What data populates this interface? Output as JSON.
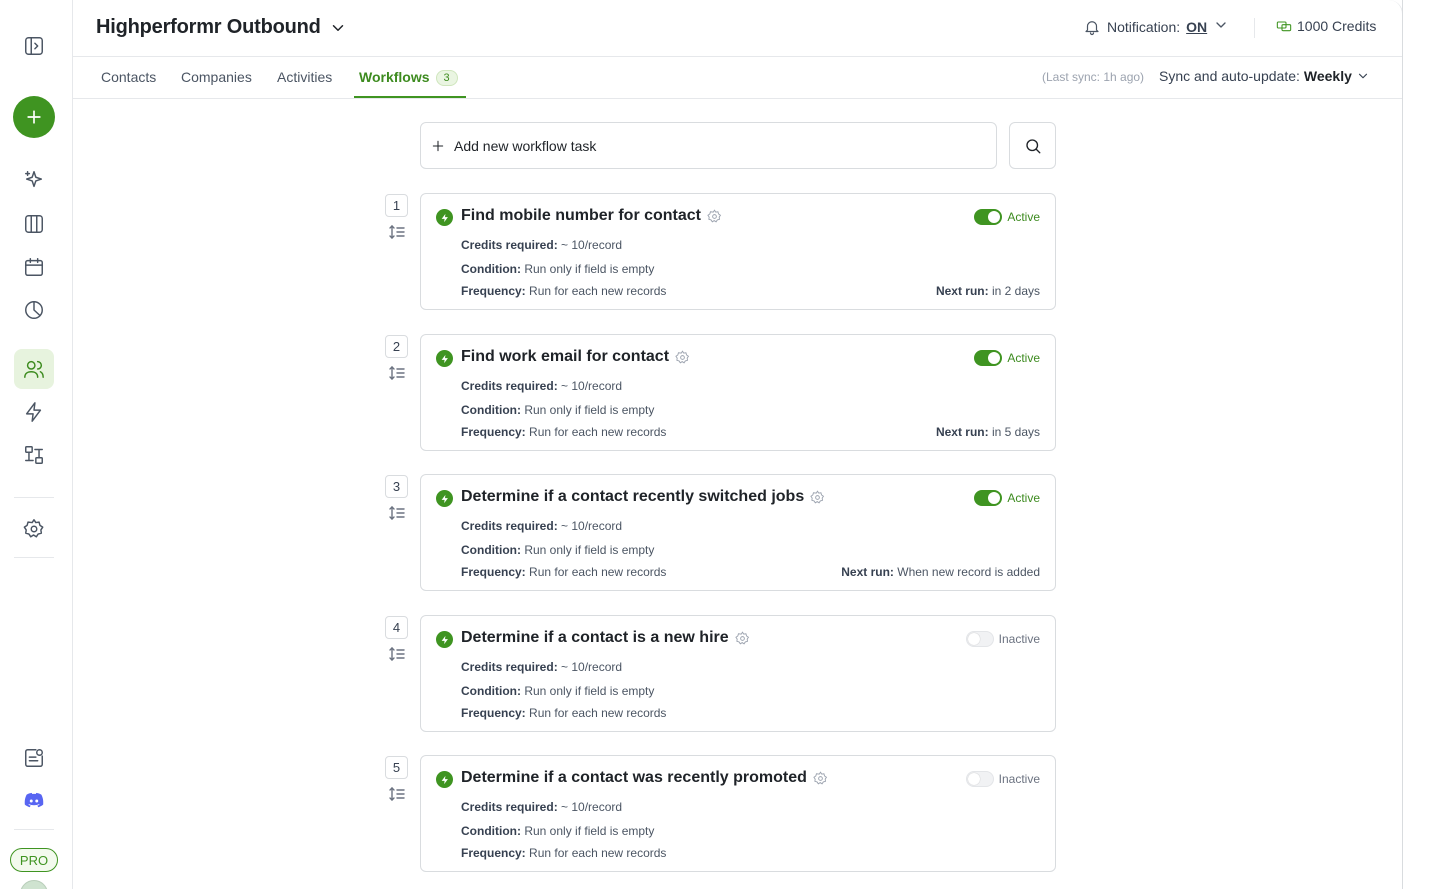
{
  "app": {
    "title": "Highperformr Outbound",
    "notification_label": "Notification:",
    "notification_value": "ON",
    "credits": "1000 Credits",
    "plan_badge": "PRO"
  },
  "tabs": [
    {
      "label": "Contacts"
    },
    {
      "label": "Companies"
    },
    {
      "label": "Activities"
    },
    {
      "label": "Workflows",
      "count": "3",
      "active": true
    }
  ],
  "sync": {
    "last_sync": "(Last sync: 1h ago)",
    "label": "Sync and auto-update:",
    "value": "Weekly"
  },
  "add_task": {
    "label": "Add new workflow task"
  },
  "labels": {
    "credits": "Credits required:",
    "condition": "Condition:",
    "frequency": "Frequency:",
    "next_run": "Next run:"
  },
  "workflows": [
    {
      "index": "1",
      "title": "Find mobile number for contact",
      "status": "Active",
      "credits": "~ 10/record",
      "condition": "Run only if field is empty",
      "frequency": "Run for each new records",
      "next_run": "in 2 days"
    },
    {
      "index": "2",
      "title": "Find work email for contact",
      "status": "Active",
      "credits": "~ 10/record",
      "condition": "Run only if field is empty",
      "frequency": "Run for each new records",
      "next_run": "in 5 days"
    },
    {
      "index": "3",
      "title": "Determine if a contact recently switched jobs",
      "status": "Active",
      "credits": "~ 10/record",
      "condition": "Run only if field is empty",
      "frequency": "Run for each new records",
      "next_run": "When new record is added"
    },
    {
      "index": "4",
      "title": "Determine if a contact is a new hire",
      "status": "Inactive",
      "credits": "~ 10/record",
      "condition": "Run only if field is empty",
      "frequency": "Run for each new records",
      "next_run": ""
    },
    {
      "index": "5",
      "title": "Determine if a contact was recently promoted",
      "status": "Inactive",
      "credits": "~ 10/record",
      "condition": "Run only if field is empty",
      "frequency": "Run for each new records",
      "next_run": ""
    }
  ],
  "sidebar": {
    "icons": [
      "sidebar-toggle-icon",
      "add-icon",
      "sparkles-icon",
      "columns-icon",
      "calendar-icon",
      "pie-chart-icon",
      "users-icon",
      "lightning-icon",
      "workflow-icon",
      "gear-icon",
      "notes-icon",
      "discord-icon"
    ]
  },
  "colors": {
    "accent": "#3f9421",
    "active_bg": "#e7f3de",
    "border": "#d9dcdf"
  }
}
